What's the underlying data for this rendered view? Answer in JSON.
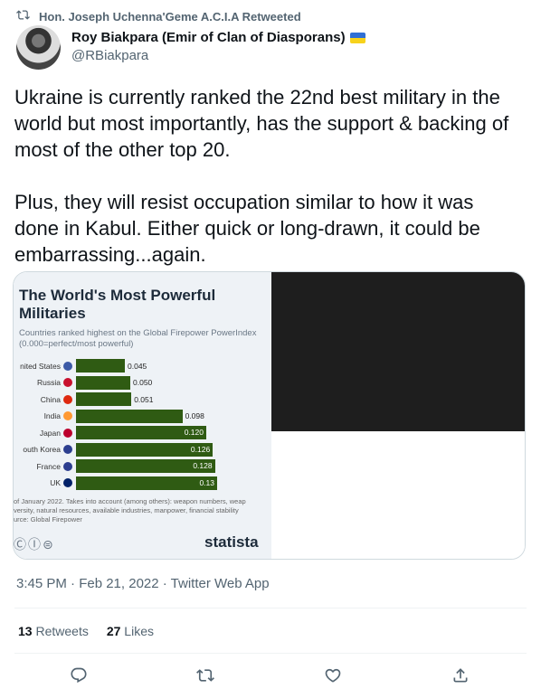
{
  "retweet_banner": {
    "text": "Hon. Joseph Uchenna'Geme A.C.I.A Retweeted",
    "icon": "retweet-icon"
  },
  "author": {
    "display_name": "Roy Biakpara (Emir of Clan of Diasporans)",
    "handle": "@RBiakpara",
    "flag_colors": [
      "#2f6fd6",
      "#f7d21c"
    ]
  },
  "tweet": {
    "text": "Ukraine is currently ranked the 22nd best military in the world but most importantly, has the support & backing of most of the other top 20.\n\nPlus, they will resist occupation similar to how it was done in Kabul. Either quick or long-drawn, it could be embarrassing...again."
  },
  "chart_data": {
    "type": "bar",
    "title": "The World's Most Powerful Militaries",
    "subtitle": "Countries ranked highest on the Global Firepower PowerIndex (0.000=perfect/most powerful)",
    "categories": [
      "United States",
      "Russia",
      "China",
      "India",
      "Japan",
      "South Korea",
      "France",
      "UK"
    ],
    "visible_labels": [
      "nited States",
      "Russia",
      "China",
      "India",
      "Japan",
      "outh Korea",
      "France",
      "UK"
    ],
    "values": [
      0.045,
      0.05,
      0.051,
      0.098,
      0.12,
      0.126,
      0.128,
      0.13
    ],
    "value_labels": [
      "0.045",
      "0.050",
      "0.051",
      "0.098",
      "0.120",
      "0.126",
      "0.128",
      "0.13"
    ],
    "flag_colors": [
      "#3c5aa6",
      "#c8102e",
      "#de2910",
      "#ff9933",
      "#bc002d",
      "#2c3e8f",
      "#2c3e8f",
      "#012169"
    ],
    "bar_color": "#2f5b13",
    "footer_lines": [
      "of January 2022. Takes into account (among others): weapon numbers, weap",
      "versity, natural resources, available industries, manpower, financial stability",
      "urce: Global Firepower"
    ],
    "brand": "statista",
    "license_icons": "ⒸⒾ⊜"
  },
  "timestamp": "3:45 PM · Feb 21, 2022 · Twitter Web App",
  "stats": {
    "retweets_count": "13",
    "retweets_label": "Retweets",
    "likes_count": "27",
    "likes_label": "Likes"
  },
  "actions": [
    "reply-icon",
    "retweet-icon",
    "like-icon",
    "share-icon"
  ],
  "colors": {
    "secondary_text": "#536471",
    "primary_text": "#0f1419",
    "divider": "#eff3f4"
  }
}
